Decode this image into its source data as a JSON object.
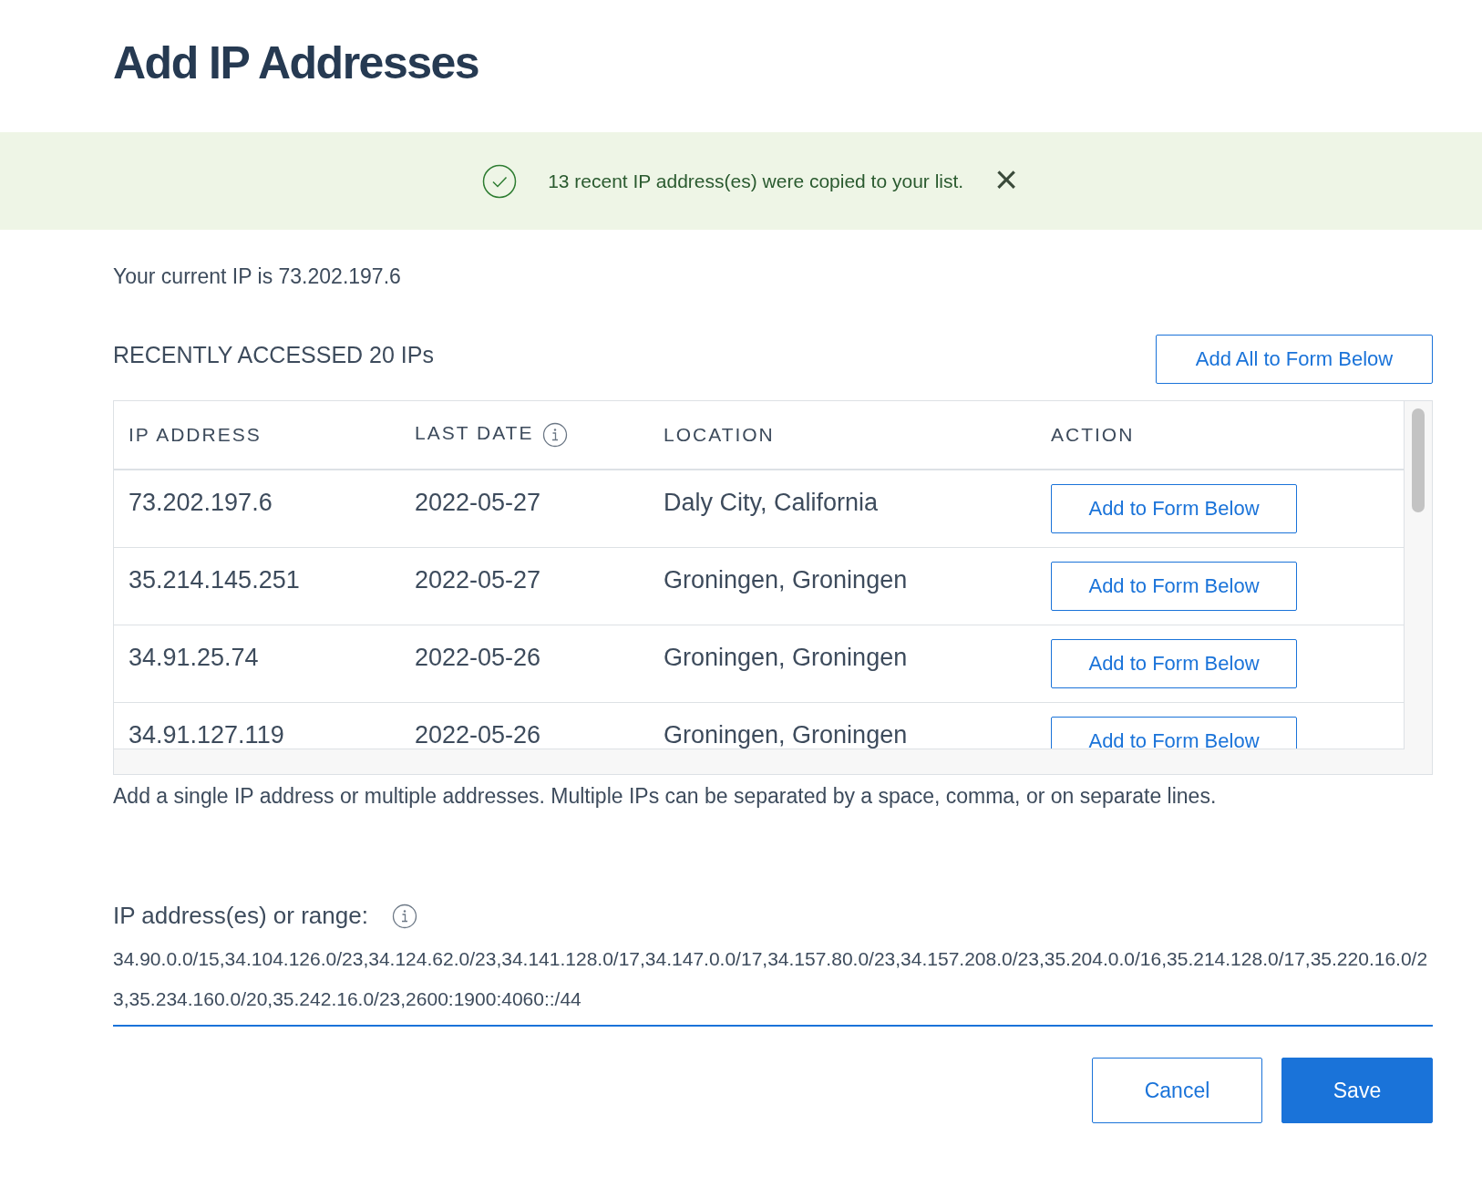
{
  "title": "Add IP Addresses",
  "banner": {
    "message": "13 recent IP address(es) were copied to your list.",
    "close": "×"
  },
  "current_ip": "Your current IP is 73.202.197.6",
  "recent": {
    "heading": "RECENTLY ACCESSED 20 IPs",
    "add_all_button": "Add All to Form Below",
    "columns": [
      "IP ADDRESS",
      "LAST DATE",
      "LOCATION",
      "ACTION"
    ],
    "rows": [
      {
        "ip": "73.202.197.6",
        "date": "2022-05-27",
        "location": "Daly City, California",
        "action": "Add to Form Below"
      },
      {
        "ip": "35.214.145.251",
        "date": "2022-05-27",
        "location": "Groningen, Groningen",
        "action": "Add to Form Below"
      },
      {
        "ip": "34.91.25.74",
        "date": "2022-05-26",
        "location": "Groningen, Groningen",
        "action": "Add to Form Below"
      },
      {
        "ip": "34.91.127.119",
        "date": "2022-05-26",
        "location": "Groningen, Groningen",
        "action": "Add to Form Below"
      }
    ]
  },
  "help_text": "Add a single IP address or multiple addresses. Multiple IPs can be separated by a space, comma, or on separate lines.",
  "field": {
    "label": "IP address(es) or range:",
    "value": "34.90.0.0/15,34.104.126.0/23,34.124.62.0/23,34.141.128.0/17,34.147.0.0/17,34.157.80.0/23,34.157.208.0/23,35.204.0.0/16,35.214.128.0/17,35.220.16.0/23,35.234.160.0/20,35.242.16.0/23,2600:1900:4060::/44"
  },
  "buttons": [
    {
      "label": "Cancel",
      "kind": "secondary"
    },
    {
      "label": "Save",
      "kind": "primary"
    }
  ]
}
